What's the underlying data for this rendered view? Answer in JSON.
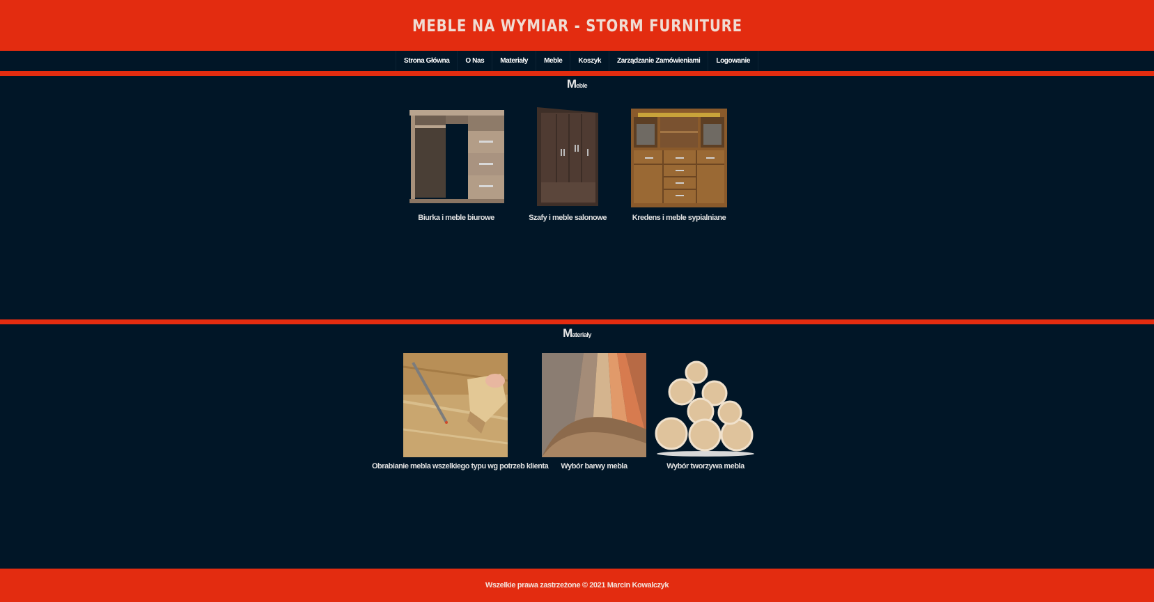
{
  "header": {
    "title": "MEBLE NA WYMIAR - STORM FURNITURE"
  },
  "nav": {
    "items": [
      "Strona Główna",
      "O Nas",
      "Materiały",
      "Meble",
      "Koszyk",
      "Zarządzanie Zamówieniami",
      "Logowanie"
    ]
  },
  "meble": {
    "title_cap": "M",
    "title_rest": "eble",
    "cards": [
      {
        "label": "Biurka i meble biurowe",
        "icon": "desk-image"
      },
      {
        "label": "Szafy i meble salonowe",
        "icon": "wardrobe-image"
      },
      {
        "label": "Kredens i meble sypialniane",
        "icon": "sideboard-image"
      }
    ]
  },
  "materialy": {
    "title_cap": "M",
    "title_rest": "ateriały",
    "cards": [
      {
        "label": "Obrabianie mebla wszelkiego typu wg potrzeb klienta",
        "icon": "woodworking-image"
      },
      {
        "label": "Wybór barwy mebla",
        "icon": "color-samples-image"
      },
      {
        "label": "Wybór tworzywa mebla",
        "icon": "logs-image"
      }
    ]
  },
  "footer": {
    "text": "Wszelkie prawa zastrzeżone © 2021 Marcin Kowalczyk"
  },
  "colors": {
    "accent": "#e32c10",
    "background": "#011627"
  }
}
